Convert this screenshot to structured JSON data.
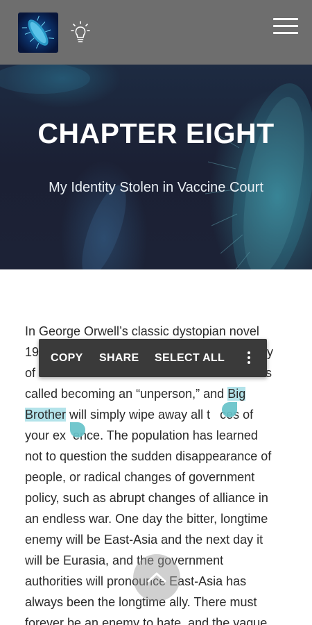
{
  "header": {
    "logo_icon": "bacterium-logo",
    "theme_icon": "lightbulb-icon",
    "menu_icon": "hamburger-menu-icon"
  },
  "hero": {
    "title": "CHAPTER EIGHT",
    "subtitle": "My Identity Stolen in Vaccine Court"
  },
  "article": {
    "lines": [
      "In George Orwell’s classic dystopian novel",
      "19",
      "of",
      "called becoming an “unperson,” and ",
      " will simply wipe away all t",
      "your ex",
      "not to question the sudden disappearance of",
      "people, or radical changes of government",
      "policy, such as abrupt changes of alliance in",
      "an endless war. One day the bitter, longtime",
      "enemy will be East-Asia and the next day it",
      "will be Eurasia, and the government",
      "authorities will pronounce East-Asia has",
      "always been the longtime ally. There must",
      "forever be an enemy to hate, and the vague"
    ],
    "line2_end": "y",
    "line3_end": "s",
    "selected_a": "Big",
    "selected_b": "Brother",
    "line5_tail": "ces of",
    "line6_tail": "ence. The population has learned"
  },
  "selection_toolbar": {
    "copy": "COPY",
    "share": "SHARE",
    "select_all": "SELECT ALL",
    "more_icon": "more-vert-icon"
  },
  "fab": {
    "icon": "chevron-up-icon"
  },
  "colors": {
    "topbar": "#6e6e6e",
    "selection": "#b3e3ea",
    "handle": "#66c2c9",
    "toolbar": "#3a3a3a"
  }
}
